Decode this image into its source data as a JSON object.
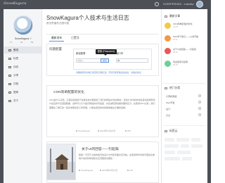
{
  "topbar": {
    "logo": "SnowKagura",
    "user": "SLEEPERJNX - Lotus",
    "ac_label": "Ac"
  },
  "sidebar": {
    "name": "SnowKagura ✓",
    "stats": [
      "17",
      "32",
      "54"
    ],
    "items": [
      {
        "label": "首页",
        "icon": "home-icon"
      },
      {
        "label": "标签",
        "icon": "tag-icon"
      },
      {
        "label": "动态",
        "icon": "chat-icon"
      },
      {
        "label": "分享",
        "icon": "share-icon"
      },
      {
        "label": "归档",
        "icon": "archive-icon"
      },
      {
        "label": "图库",
        "icon": "image-icon"
      },
      {
        "label": "关于",
        "icon": "about-icon"
      }
    ]
  },
  "header": {
    "title": "SnowKagura个人技术与生活日志",
    "subtitle": "愿世界遍布无限可能"
  },
  "tabs": [
    "最新发布",
    "已置顶"
  ],
  "card1": {
    "title": "问题配置",
    "form_title": "新版配置",
    "port_label": "端口号",
    "field_placeholder": "请输入",
    "tooltip": "更新 (Password)",
    "badge": "保存",
    "port_value": "80",
    "note": "请确保填写的端口和密码正确无误，否则可能导致连接失败，请稍后重试"
  },
  "post1": {
    "title": "CDN简单配置的优化",
    "body": "CDN是什么东西，它其实就相当于在很多地方都放置了我们的网站文件的副本，当用户访问的时候会自动选择离用户最近的节点返回数据，这样可以大大提高网站的访问速度，并且减轻源站服务器的压力。在使用CDN之前，我们需要先了解它的一些基本概念和工作原理，以便在配置的时候能够做出正确的选择。",
    "author": "SnowKagura",
    "date": "2024年01月23日",
    "views": "254"
  },
  "post2": {
    "title": "关于UI的回答——引起篇",
    "body": "随着一不同于之前的我们的设计方式和页面交互风格，在使用场景中我们更加注重用户的实际体验和交互流程的合理性……",
    "author": "SnowKagura",
    "date": "2024年05月10日",
    "views": "133"
  },
  "right": {
    "latest_head": "最新文章",
    "posts": [
      {
        "text": "CDN简单配置的优化",
        "date": "01-23"
      },
      {
        "text": "Web学习笔记——从零开始",
        "date": "12-11"
      },
      {
        "text": "关于UI的回答——引起篇",
        "date": "05-10"
      },
      {
        "text": "欢迎使用与指南",
        "date": "04-02"
      }
    ],
    "cat_head": "热门分类",
    "categories": [
      {
        "label": "计算机网络",
        "count": "7"
      },
      {
        "label": "Web开发",
        "count": "5"
      },
      {
        "label": "设计",
        "count": "3"
      },
      {
        "label": "日记",
        "count": "9"
      }
    ],
    "tag_head": "标签云"
  },
  "colors": {
    "topbar": "#4c5056",
    "accent": "#5b8fd6",
    "sidebar_bg": "#f4f5f7"
  }
}
